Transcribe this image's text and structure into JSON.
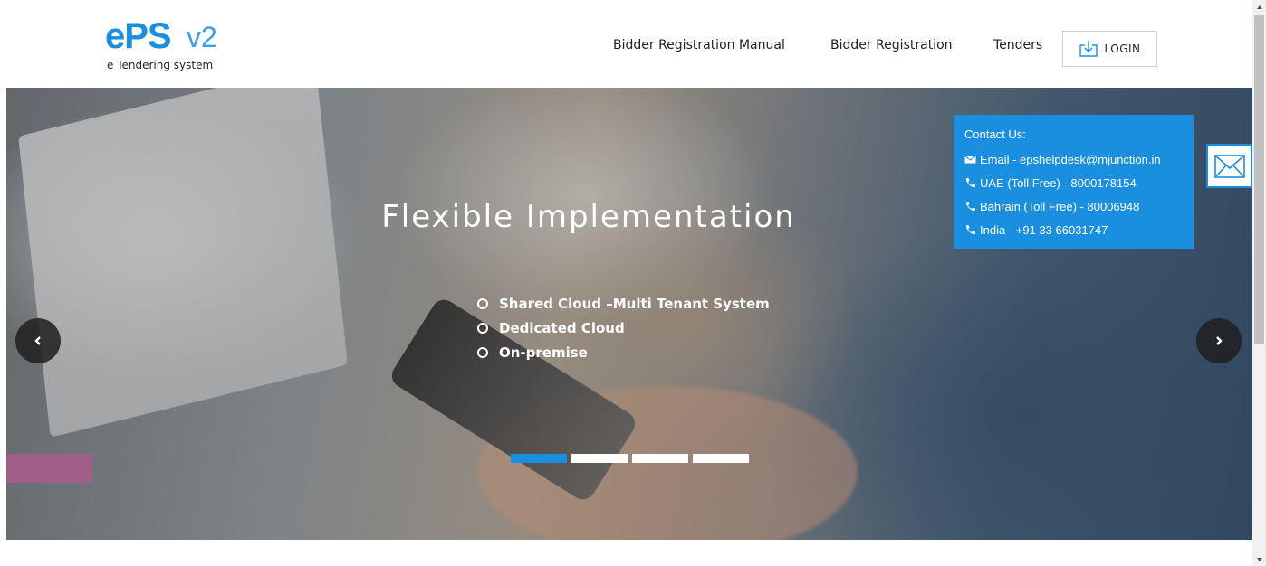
{
  "logo": {
    "mark": "ePS",
    "version": "v2",
    "tagline": "e Tendering system"
  },
  "nav": {
    "items": [
      {
        "label": "Bidder Registration Manual"
      },
      {
        "label": "Bidder Registration"
      },
      {
        "label": "Tenders"
      }
    ],
    "login_label": "LOGIN"
  },
  "hero": {
    "title": "Flexible Implementation",
    "bullets": [
      "Shared Cloud –Multi Tenant System",
      "Dedicated Cloud",
      "On-premise"
    ],
    "slide_count": 4,
    "active_slide": 1
  },
  "contact": {
    "title": "Contact Us:",
    "email": "Email - epshelpdesk@mjunction.in",
    "uae": "UAE (Toll Free) - 8000178154",
    "bahrain": "Bahrain (Toll Free) - 80006948",
    "india": "India - +91 33 66031747"
  },
  "colors": {
    "accent": "#1a8fe0",
    "contact_bg": "#1a8fe0",
    "text_dark": "#222222"
  },
  "icons": {
    "login": "login-download-icon",
    "mail": "envelope-icon",
    "phone": "phone-icon",
    "prev": "chevron-left-icon",
    "next": "chevron-right-icon"
  }
}
